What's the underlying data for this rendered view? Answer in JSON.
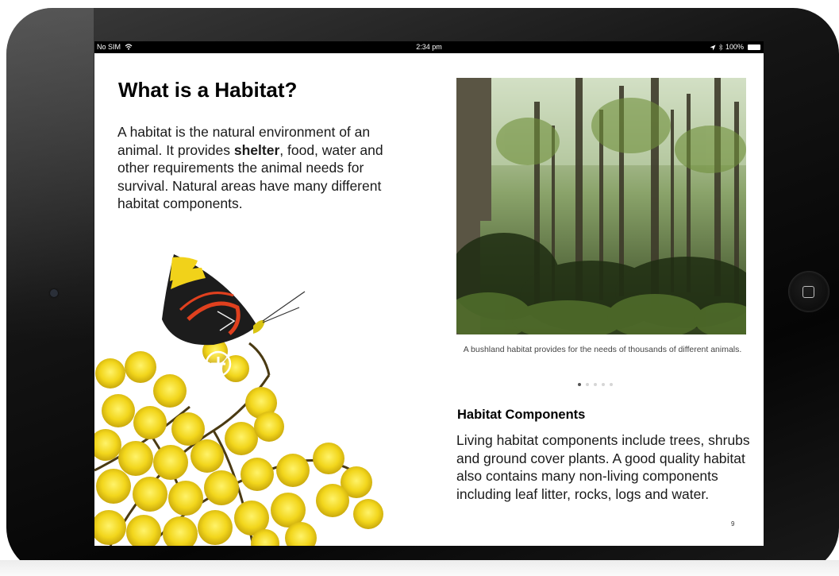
{
  "status_bar": {
    "carrier": "No SIM",
    "time": "2:34 pm",
    "battery": "100%"
  },
  "page": {
    "title": "What is a Habitat?",
    "intro": {
      "before": "A habitat is the natural environment of an animal. It provides ",
      "bold": "shelter",
      "after": ", food, water and other requirements the animal needs for survival. Natural areas have many different habitat components."
    },
    "photo_caption": "A bushland habitat provides for the needs of thousands of different animals.",
    "gallery": {
      "count": 5,
      "active_index": 0
    },
    "components_heading": "Habitat Components",
    "components_text": "Living habitat components include trees, shrubs and ground cover plants. A good quality habitat also contains many non-living components including leaf litter, rocks, logs and water.",
    "page_number": "9"
  },
  "icons": {
    "wifi": "wifi-icon",
    "location": "location-arrow-icon",
    "bluetooth": "bluetooth-icon",
    "battery": "battery-icon",
    "zoom": "plus-circle-icon",
    "home": "home-button-icon"
  },
  "colors": {
    "device_bezel": "#0a0a0a",
    "screen_bg": "#ffffff",
    "status_bar": "#000000",
    "text": "#1a1a1a"
  }
}
